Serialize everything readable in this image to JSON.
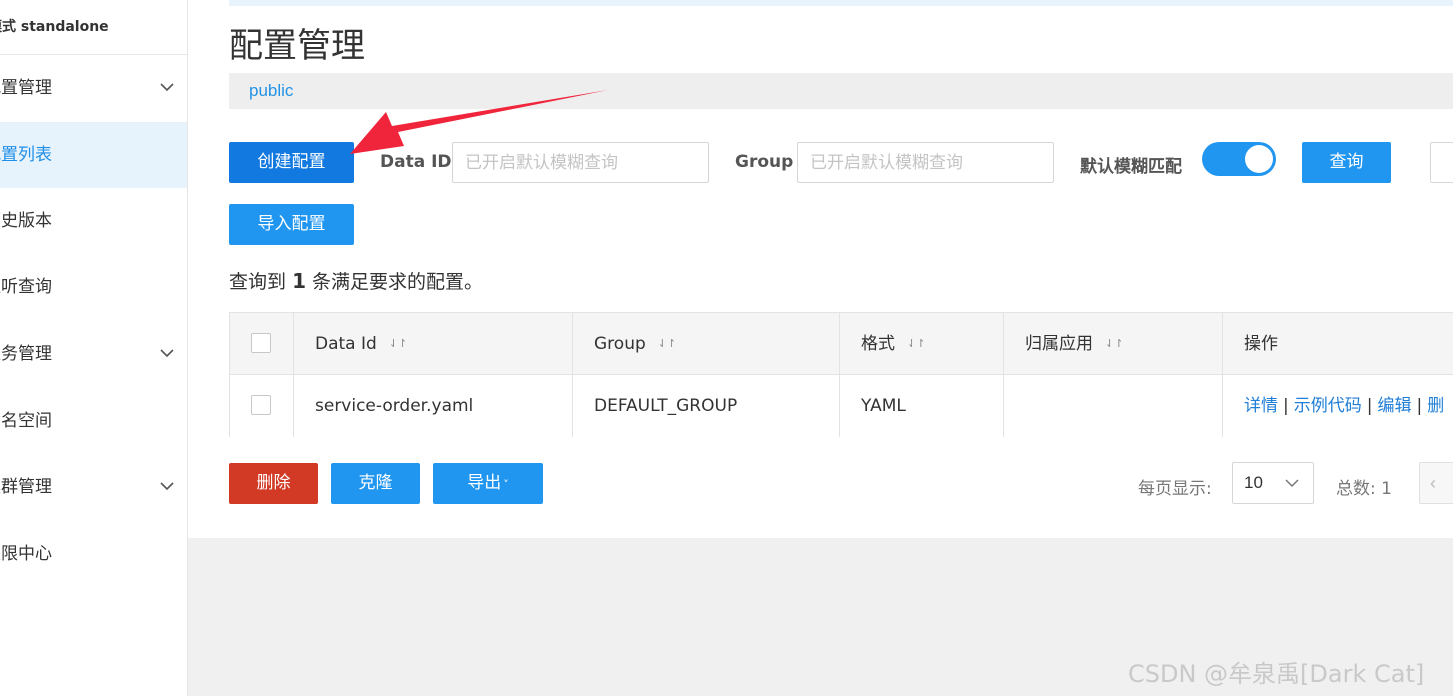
{
  "sidebar": {
    "title": "模式 standalone",
    "items": [
      {
        "label": "配置管理",
        "expandable": true,
        "active": false
      },
      {
        "label": "配置列表",
        "expandable": false,
        "active": true
      },
      {
        "label": "历史版本",
        "expandable": false,
        "active": false
      },
      {
        "label": "监听查询",
        "expandable": false,
        "active": false
      },
      {
        "label": "服务管理",
        "expandable": true,
        "active": false
      },
      {
        "label": "命名空间",
        "expandable": false,
        "active": false
      },
      {
        "label": "集群管理",
        "expandable": true,
        "active": false
      },
      {
        "label": "权限中心",
        "expandable": false,
        "active": false
      }
    ]
  },
  "main": {
    "title": "配置管理",
    "namespace": "public",
    "create_btn": "创建配置",
    "import_btn": "导入配置",
    "dataid_label": "Data ID",
    "dataid_placeholder": "已开启默认模糊查询",
    "group_label": "Group",
    "group_placeholder": "已开启默认模糊查询",
    "fuzzy_label": "默认模糊匹配",
    "fuzzy_enabled": true,
    "query_btn": "查询",
    "result_prefix": "查询到",
    "result_count": "1",
    "result_suffix": "条满足要求的配置。"
  },
  "table": {
    "columns": [
      "Data Id",
      "Group",
      "格式",
      "归属应用",
      "操作"
    ],
    "rows": [
      {
        "data_id": "service-order.yaml",
        "group": "DEFAULT_GROUP",
        "format": "YAML",
        "app": "",
        "ops": [
          "详情",
          "示例代码",
          "编辑",
          "删"
        ]
      }
    ]
  },
  "footer": {
    "delete_btn": "删除",
    "clone_btn": "克隆",
    "export_btn": "导出",
    "page_size_label": "每页显示:",
    "page_size": "10",
    "total_label": "总数: 1"
  },
  "watermark": "CSDN @牟泉禹[Dark Cat]",
  "colors": {
    "primary": "#2096f0",
    "primary_dark": "#1279e0",
    "danger": "#d23a26",
    "annotation_arrow": "#f0243a"
  }
}
